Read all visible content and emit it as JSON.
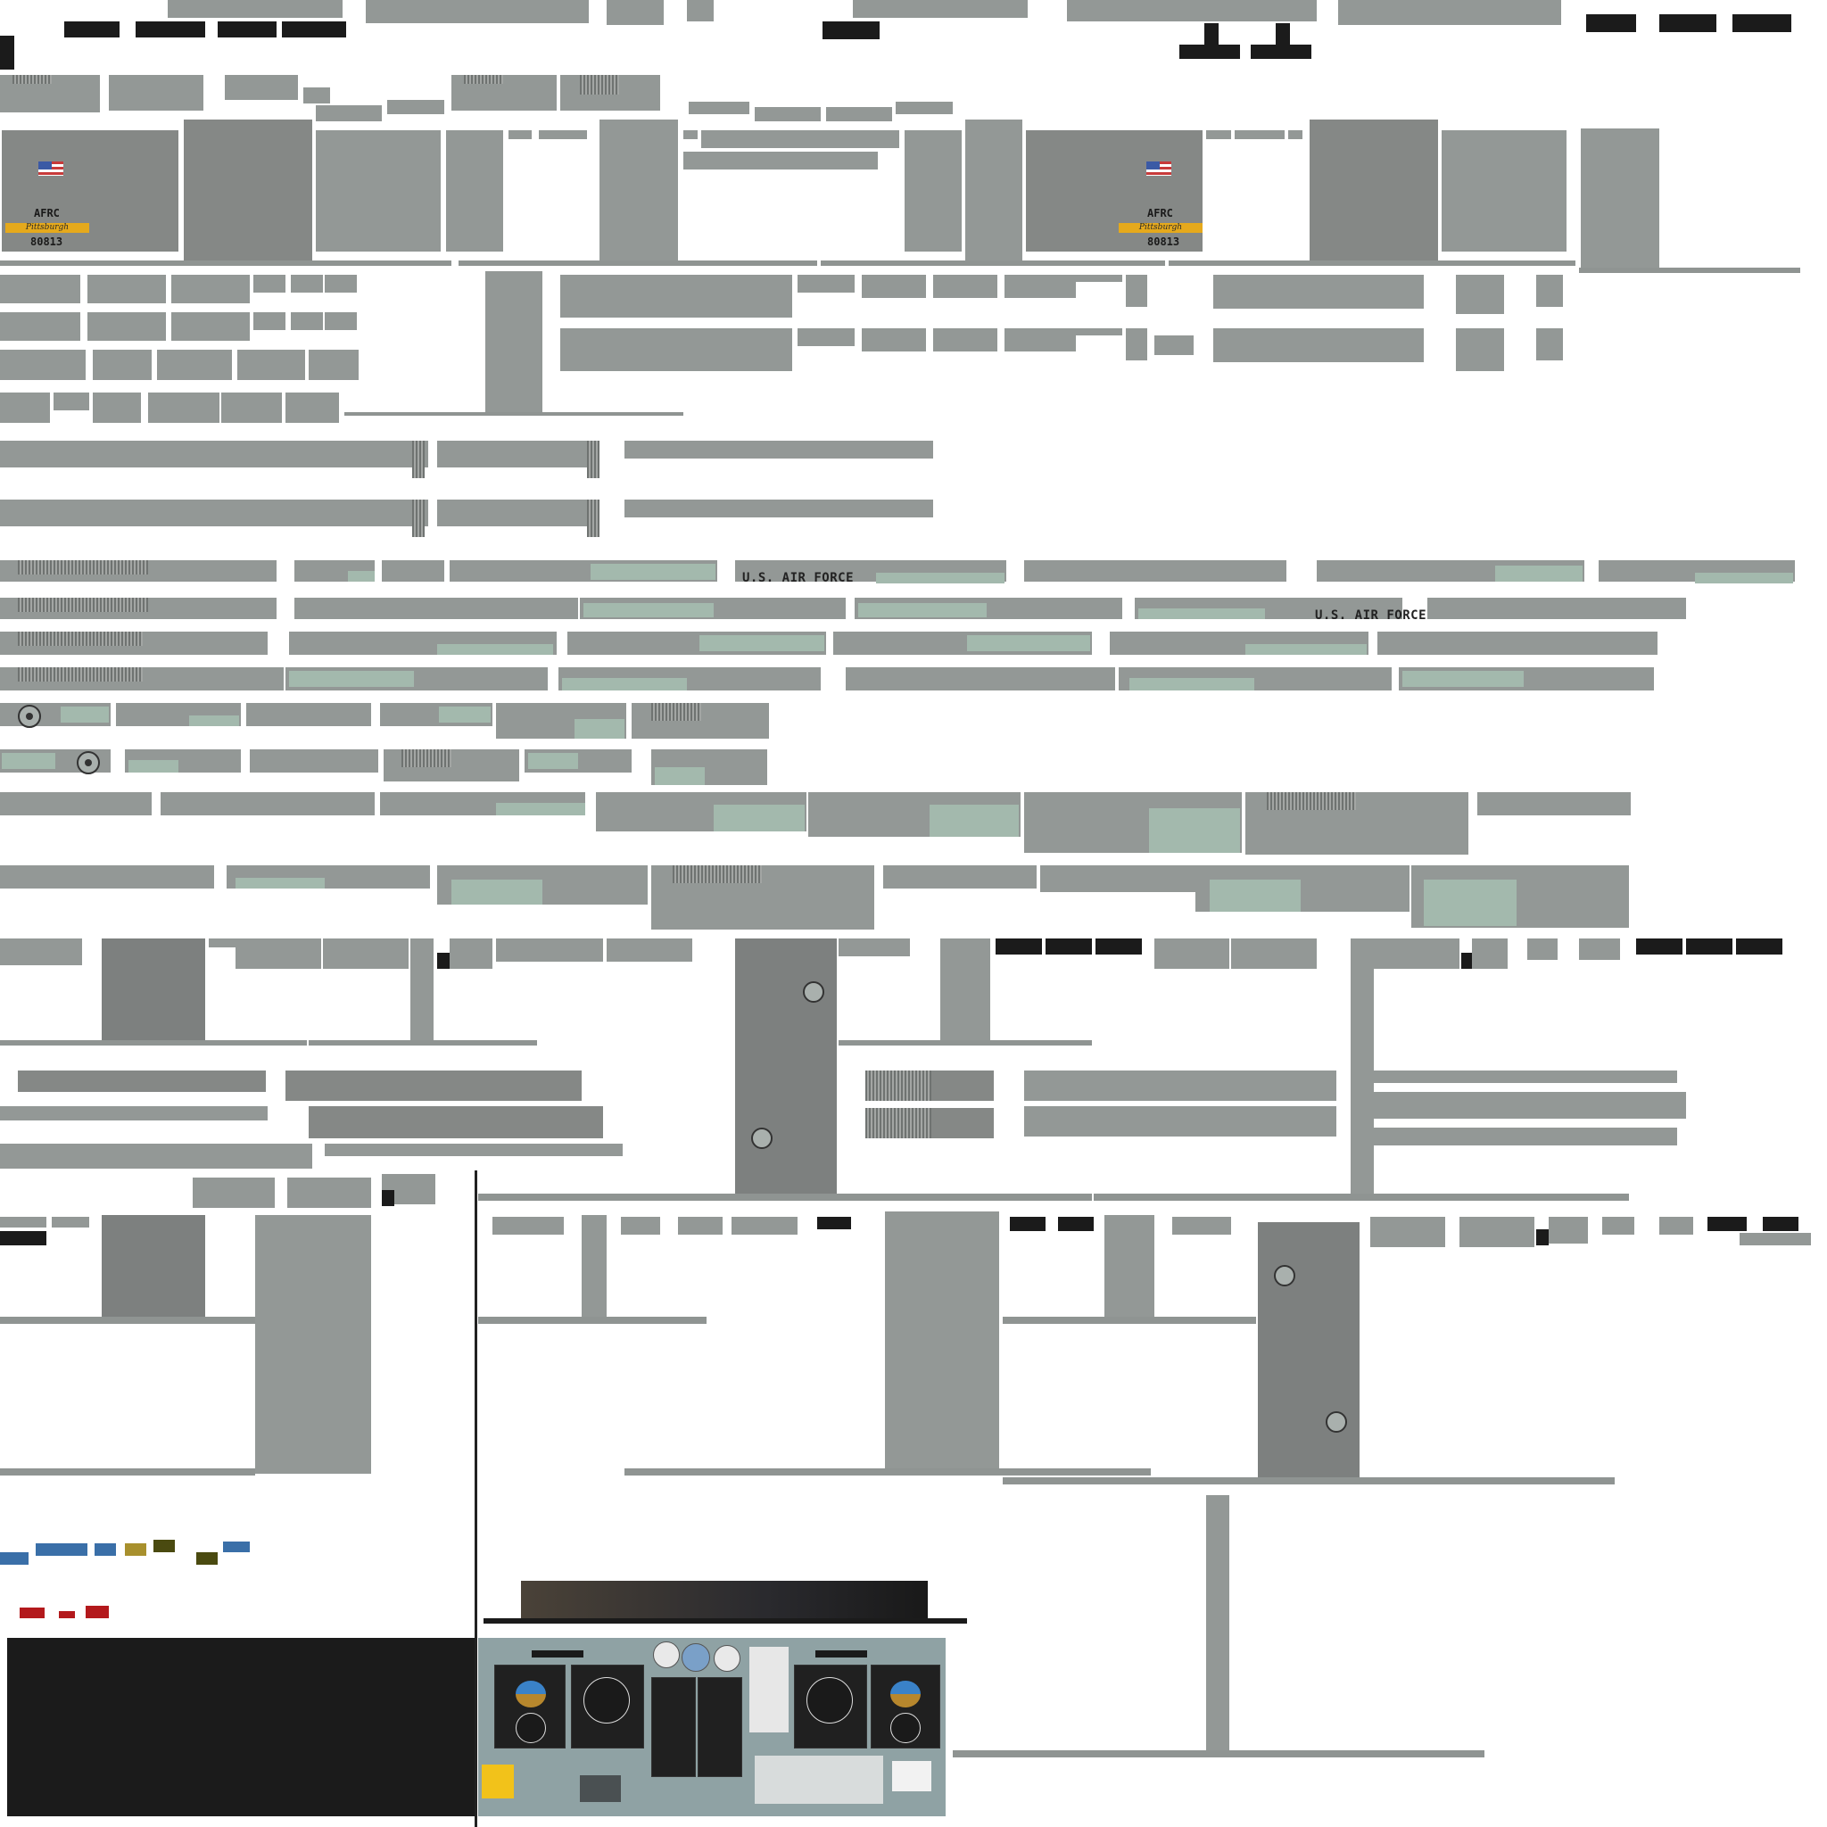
{
  "markings": {
    "afrc_left": "AFRC",
    "city_left": "Pittsburgh",
    "tail_left": "80813",
    "afrc_right": "AFRC",
    "city_right": "Pittsburgh",
    "tail_right": "80813",
    "usaf_1": "U.S. AIR FORCE",
    "usaf_2": "U.S. AIR FORCE"
  },
  "colors": {
    "panel_gray": "#939896",
    "panel_dark": "#7d807f",
    "accent_mint": "#a3b9ad",
    "stripe_yellow": "#e5a91c",
    "flag_red": "#c73a3a",
    "flag_blue": "#3b5aa5",
    "cockpit_teal": "#8fa2a4",
    "black": "#1b1b1b"
  },
  "icons": {
    "flag": "us-flag-icon",
    "roundel": "usaf-roundel-icon",
    "propeller": "propeller-hub-icon"
  }
}
